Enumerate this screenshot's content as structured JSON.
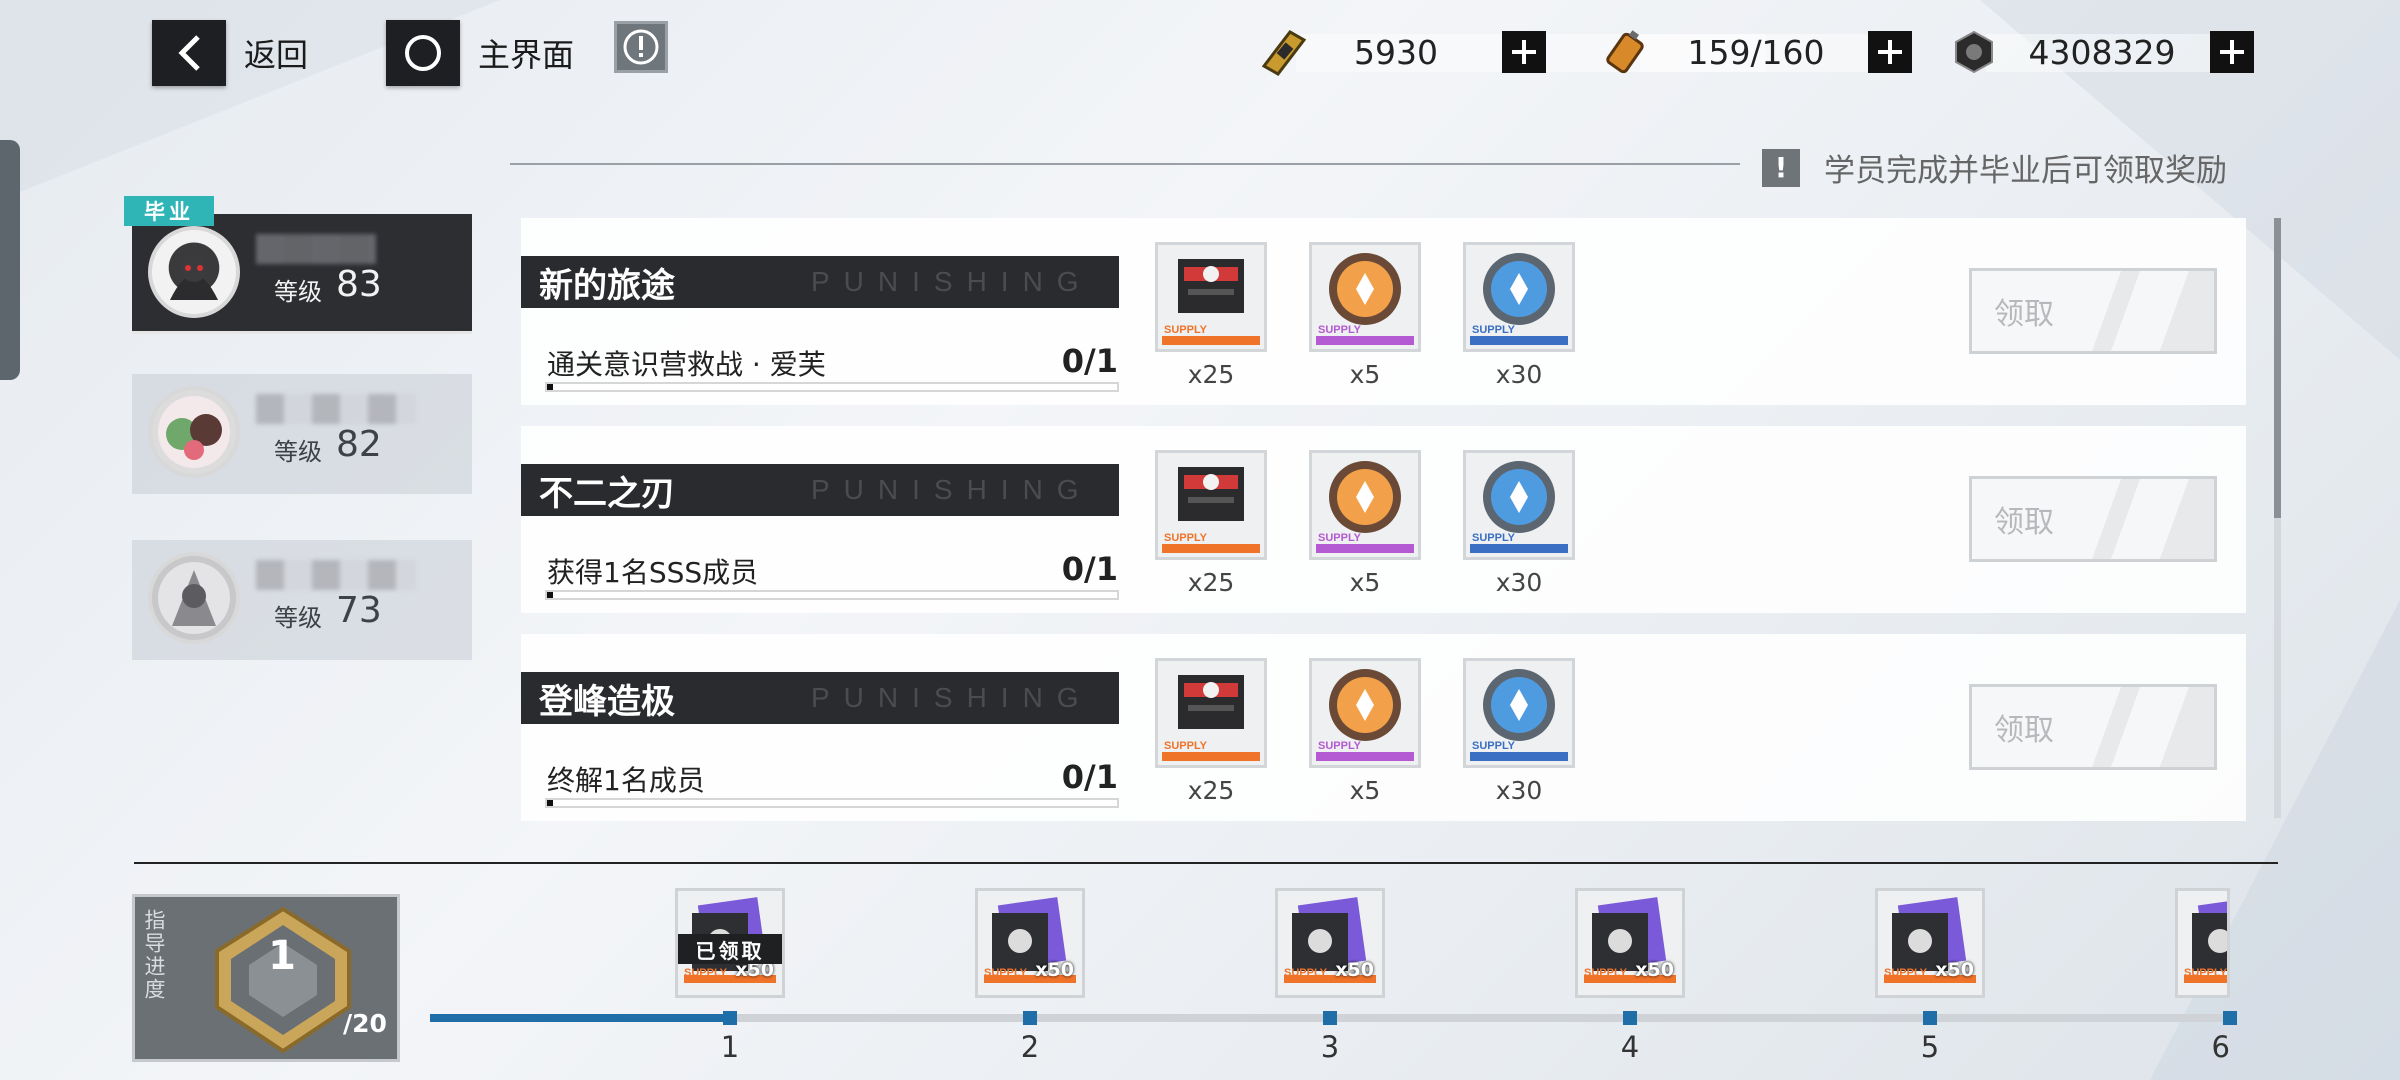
{
  "top": {
    "back_label": "返回",
    "home_label": "主界面"
  },
  "resources": [
    {
      "icon": "gold-ticket-icon",
      "value": "5930"
    },
    {
      "icon": "stamina-battery-icon",
      "value": "159/160"
    },
    {
      "icon": "coin-nut-icon",
      "value": "4308329"
    }
  ],
  "notice": {
    "text": "学员完成并毕业后可领取奖励"
  },
  "students": [
    {
      "badge": "毕业",
      "level_label": "等级",
      "level": "83",
      "active": true
    },
    {
      "level_label": "等级",
      "level": "82",
      "active": false
    },
    {
      "level_label": "等级",
      "level": "73",
      "active": false
    }
  ],
  "missions": [
    {
      "title": "新的旅途",
      "deco": "PUNISHING",
      "desc": "通关意识营救战 · 爱芙",
      "progress": "0/1",
      "progress_fraction": 0,
      "rewards": [
        {
          "icon": "supply-box-icon",
          "supply_text": "SUPPLY",
          "qty": "x25",
          "strip_color": "#f0732a"
        },
        {
          "icon": "orange-coin-icon",
          "supply_text": "SUPPLY",
          "qty": "x5",
          "strip_color": "#b45ad2"
        },
        {
          "icon": "blue-coin-icon",
          "supply_text": "SUPPLY",
          "qty": "x30",
          "strip_color": "#3a6fc4"
        }
      ],
      "claim_label": "领取"
    },
    {
      "title": "不二之刃",
      "deco": "PUNISHING",
      "desc": "获得1名SSS成员",
      "progress": "0/1",
      "progress_fraction": 0,
      "rewards": [
        {
          "icon": "supply-box-icon",
          "supply_text": "SUPPLY",
          "qty": "x25",
          "strip_color": "#f0732a"
        },
        {
          "icon": "orange-coin-icon",
          "supply_text": "SUPPLY",
          "qty": "x5",
          "strip_color": "#b45ad2"
        },
        {
          "icon": "blue-coin-icon",
          "supply_text": "SUPPLY",
          "qty": "x30",
          "strip_color": "#3a6fc4"
        }
      ],
      "claim_label": "领取"
    },
    {
      "title": "登峰造极",
      "deco": "PUNISHING",
      "desc": "终解1名成员",
      "progress": "0/1",
      "progress_fraction": 0,
      "rewards": [
        {
          "icon": "supply-box-icon",
          "supply_text": "SUPPLY",
          "qty": "x25",
          "strip_color": "#f0732a"
        },
        {
          "icon": "orange-coin-icon",
          "supply_text": "SUPPLY",
          "qty": "x5",
          "strip_color": "#b45ad2"
        },
        {
          "icon": "blue-coin-icon",
          "supply_text": "SUPPLY",
          "qty": "x30",
          "strip_color": "#3a6fc4"
        }
      ],
      "claim_label": "领取"
    }
  ],
  "guide": {
    "side_label": "指导进度",
    "rank": "1",
    "total": "/20",
    "stages": [
      {
        "num": "1",
        "qty": "x50",
        "claimed": true,
        "claimed_label": "已领取",
        "supply_text": "SUPPLY"
      },
      {
        "num": "2",
        "qty": "x50",
        "claimed": false,
        "supply_text": "SUPPLY"
      },
      {
        "num": "3",
        "qty": "x50",
        "claimed": false,
        "supply_text": "SUPPLY"
      },
      {
        "num": "4",
        "qty": "x50",
        "claimed": false,
        "supply_text": "SUPPLY"
      },
      {
        "num": "5",
        "qty": "x50",
        "claimed": false,
        "supply_text": "SUPPLY"
      },
      {
        "num": "6",
        "qty": "",
        "claimed": false,
        "supply_text": "SUPPLY"
      }
    ]
  },
  "colors": {
    "accent_blue": "#1f6ea8",
    "badge_teal": "#2fb5b6",
    "dark_panel": "#2a2b2e"
  }
}
